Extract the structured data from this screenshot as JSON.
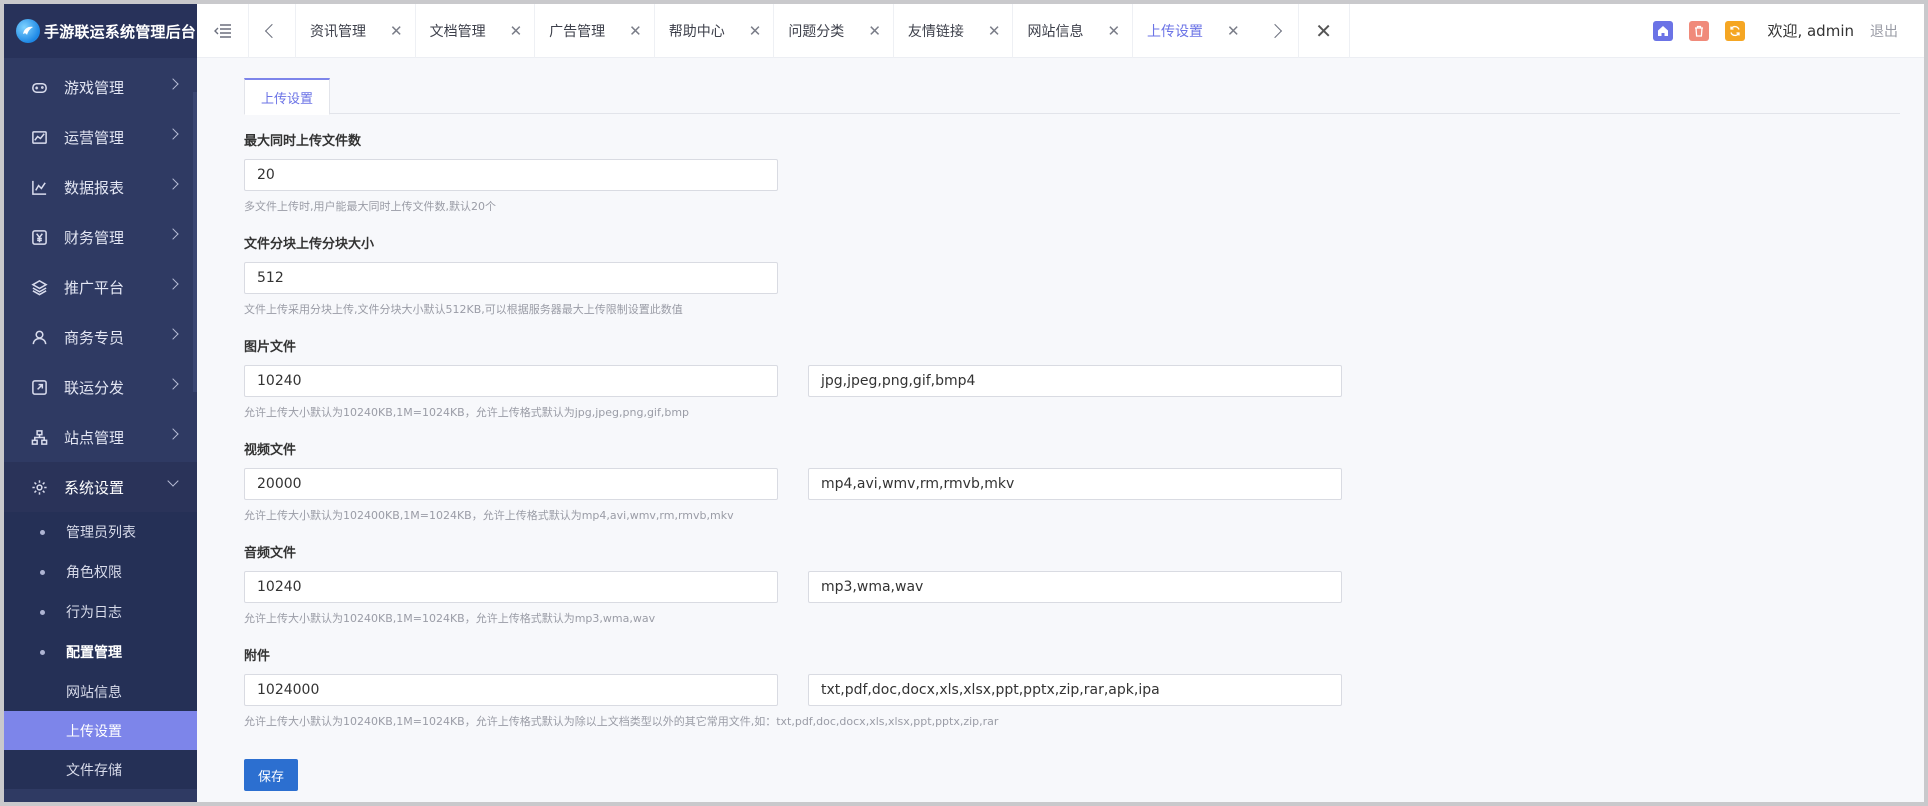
{
  "app": {
    "title": "手游联运系统管理后台"
  },
  "sidebar": {
    "menu": [
      {
        "label": "游戏管理",
        "icon": "gamepad-icon"
      },
      {
        "label": "运营管理",
        "icon": "chart-area-icon"
      },
      {
        "label": "数据报表",
        "icon": "line-chart-icon"
      },
      {
        "label": "财务管理",
        "icon": "yen-icon"
      },
      {
        "label": "推广平台",
        "icon": "layers-icon"
      },
      {
        "label": "商务专员",
        "icon": "user-icon"
      },
      {
        "label": "联运分发",
        "icon": "share-icon"
      },
      {
        "label": "站点管理",
        "icon": "sitemap-icon"
      },
      {
        "label": "系统设置",
        "icon": "gear-icon"
      }
    ],
    "system_sub": [
      {
        "label": "管理员列表"
      },
      {
        "label": "角色权限"
      },
      {
        "label": "行为日志"
      },
      {
        "label": "配置管理"
      }
    ],
    "config_sub": [
      {
        "label": "网站信息"
      },
      {
        "label": "上传设置"
      },
      {
        "label": "文件存储"
      }
    ]
  },
  "topbar": {
    "tabs": [
      {
        "label": "资讯管理"
      },
      {
        "label": "文档管理"
      },
      {
        "label": "广告管理"
      },
      {
        "label": "帮助中心"
      },
      {
        "label": "问题分类"
      },
      {
        "label": "友情链接"
      },
      {
        "label": "网站信息"
      },
      {
        "label": "上传设置"
      }
    ],
    "close_glyph": "✕",
    "welcome": "欢迎, admin",
    "logout": "退出",
    "icon_colors": {
      "home": "#6b73e6",
      "trash": "#f08a7a",
      "refresh": "#f5a623"
    }
  },
  "page": {
    "tab": "上传设置",
    "fields": {
      "max_files": {
        "label": "最大同时上传文件数",
        "value": "20",
        "hint": "多文件上传时,用户能最大同时上传文件数,默认20个"
      },
      "chunk": {
        "label": "文件分块上传分块大小",
        "value": "512",
        "hint": "文件上传采用分块上传,文件分块大小默认512KB,可以根据服务器最大上传限制设置此数值"
      },
      "image": {
        "label": "图片文件",
        "size": "10240",
        "formats": "jpg,jpeg,png,gif,bmp4",
        "hint": "允许上传大小默认为10240KB,1M=1024KB，允许上传格式默认为jpg,jpeg,png,gif,bmp"
      },
      "video": {
        "label": "视频文件",
        "size": "20000",
        "formats": "mp4,avi,wmv,rm,rmvb,mkv",
        "hint": "允许上传大小默认为102400KB,1M=1024KB，允许上传格式默认为mp4,avi,wmv,rm,rmvb,mkv"
      },
      "audio": {
        "label": "音频文件",
        "size": "10240",
        "formats": "mp3,wma,wav",
        "hint": "允许上传大小默认为10240KB,1M=1024KB，允许上传格式默认为mp3,wma,wav"
      },
      "attachment": {
        "label": "附件",
        "size": "1024000",
        "formats": "txt,pdf,doc,docx,xls,xlsx,ppt,pptx,zip,rar,apk,ipa",
        "hint": "允许上传大小默认为10240KB,1M=1024KB，允许上传格式默认为除以上文档类型以外的其它常用文件,如：txt,pdf,doc,docx,xls,xlsx,ppt,pptx,zip,rar"
      }
    },
    "save_label": "保存"
  }
}
